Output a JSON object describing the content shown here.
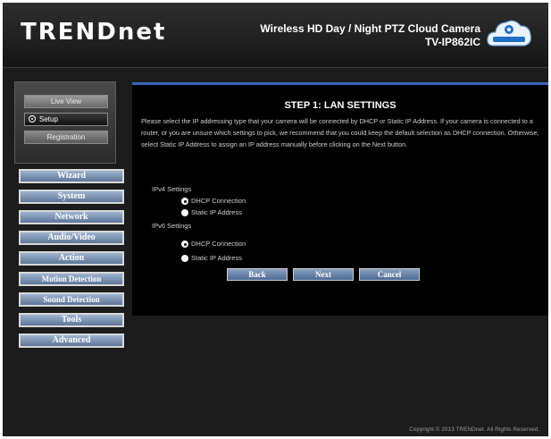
{
  "header": {
    "logo": "TRENDnet",
    "product_line1": "Wireless HD Day / Night PTZ Cloud Camera",
    "product_line2": "TV-IP862IC",
    "cloud_badge": "TRENDnet Cloud"
  },
  "sidebar": {
    "top_buttons": [
      "Live View",
      "Setup",
      "Registration"
    ],
    "menu": [
      "Wizard",
      "System",
      "Network",
      "Audio/Video",
      "Action",
      "Motion Detection",
      "Sound Detection",
      "Tools",
      "Advanced"
    ]
  },
  "wizard": {
    "title": "STEP 1: LAN SETTINGS",
    "description": "Please select the IP addressing type that your camera will be connected by DHCP or Static IP Address. If your camera is connected to a router, or you are unsure which settings to pick, we recommend that you could keep the default selection as DHCP connection. Otherwise, select Static IP Address to assign an IP address manually before clicking on the Next button.",
    "ipv4": {
      "label": "IPv4 Settings",
      "options": [
        "DHCP Connection",
        "Static IP Address"
      ],
      "selected": "DHCP Connection"
    },
    "ipv6": {
      "label": "IPv6 Settings",
      "options": [
        "DHCP Connection",
        "Static IP Address"
      ],
      "selected": "DHCP Connection"
    },
    "buttons": {
      "back": "Back",
      "next": "Next",
      "cancel": "Cancel"
    }
  },
  "footer": {
    "copyright": "Copyright © 2013 TRENDnet. All Rights Reserved."
  },
  "colors": {
    "accent": "#3a67c0",
    "menu": "#6f87a8",
    "background": "#1c1c1c"
  }
}
